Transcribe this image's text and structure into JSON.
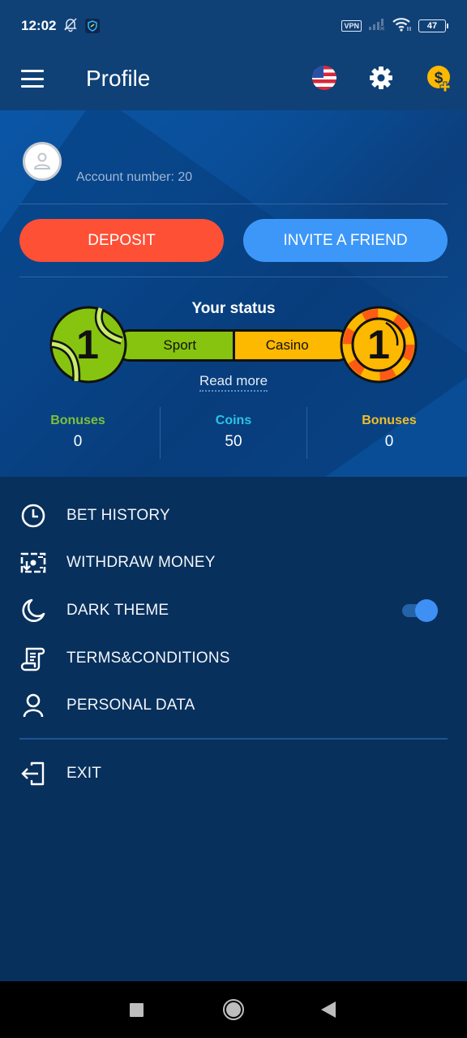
{
  "status_bar": {
    "time": "12:02",
    "vpn_label": "VPN",
    "battery": "47",
    "icons": [
      "bell-off-icon",
      "shield-app-icon",
      "signal-icon",
      "wifi-icon",
      "battery-icon"
    ]
  },
  "app_bar": {
    "title": "Profile",
    "icons": [
      "menu-icon",
      "us-flag-icon",
      "gear-icon",
      "dollar-plus-icon"
    ]
  },
  "profile": {
    "account_label": "Account number: 20",
    "deposit_label": "DEPOSIT",
    "invite_label": "INVITE A FRIEND"
  },
  "status": {
    "title": "Your status",
    "sport_label": "Sport",
    "casino_label": "Casino",
    "sport_level": "1",
    "casino_level": "1",
    "read_more": "Read more"
  },
  "stats": [
    {
      "label": "Bonuses",
      "value": "0",
      "color": "#7cc13a"
    },
    {
      "label": "Coins",
      "value": "50",
      "color": "#2cc3e8"
    },
    {
      "label": "Bonuses",
      "value": "0",
      "color": "#f1bd2a"
    }
  ],
  "menu": {
    "items": [
      {
        "label": "BET HISTORY",
        "icon": "clock-icon"
      },
      {
        "label": "WITHDRAW MONEY",
        "icon": "withdraw-money-icon"
      },
      {
        "label": "DARK THEME",
        "icon": "moon-icon",
        "toggle_on": true
      },
      {
        "label": "TERMS&CONDITIONS",
        "icon": "document-scroll-icon"
      },
      {
        "label": "PERSONAL DATA",
        "icon": "person-icon"
      }
    ],
    "exit_label": "EXIT"
  },
  "colors": {
    "deposit": "#fd5035",
    "invite": "#3c97f8",
    "sport": "#86c40f",
    "casino": "#fdb800",
    "toggle": "#3e90f5",
    "background": "#08305c"
  }
}
